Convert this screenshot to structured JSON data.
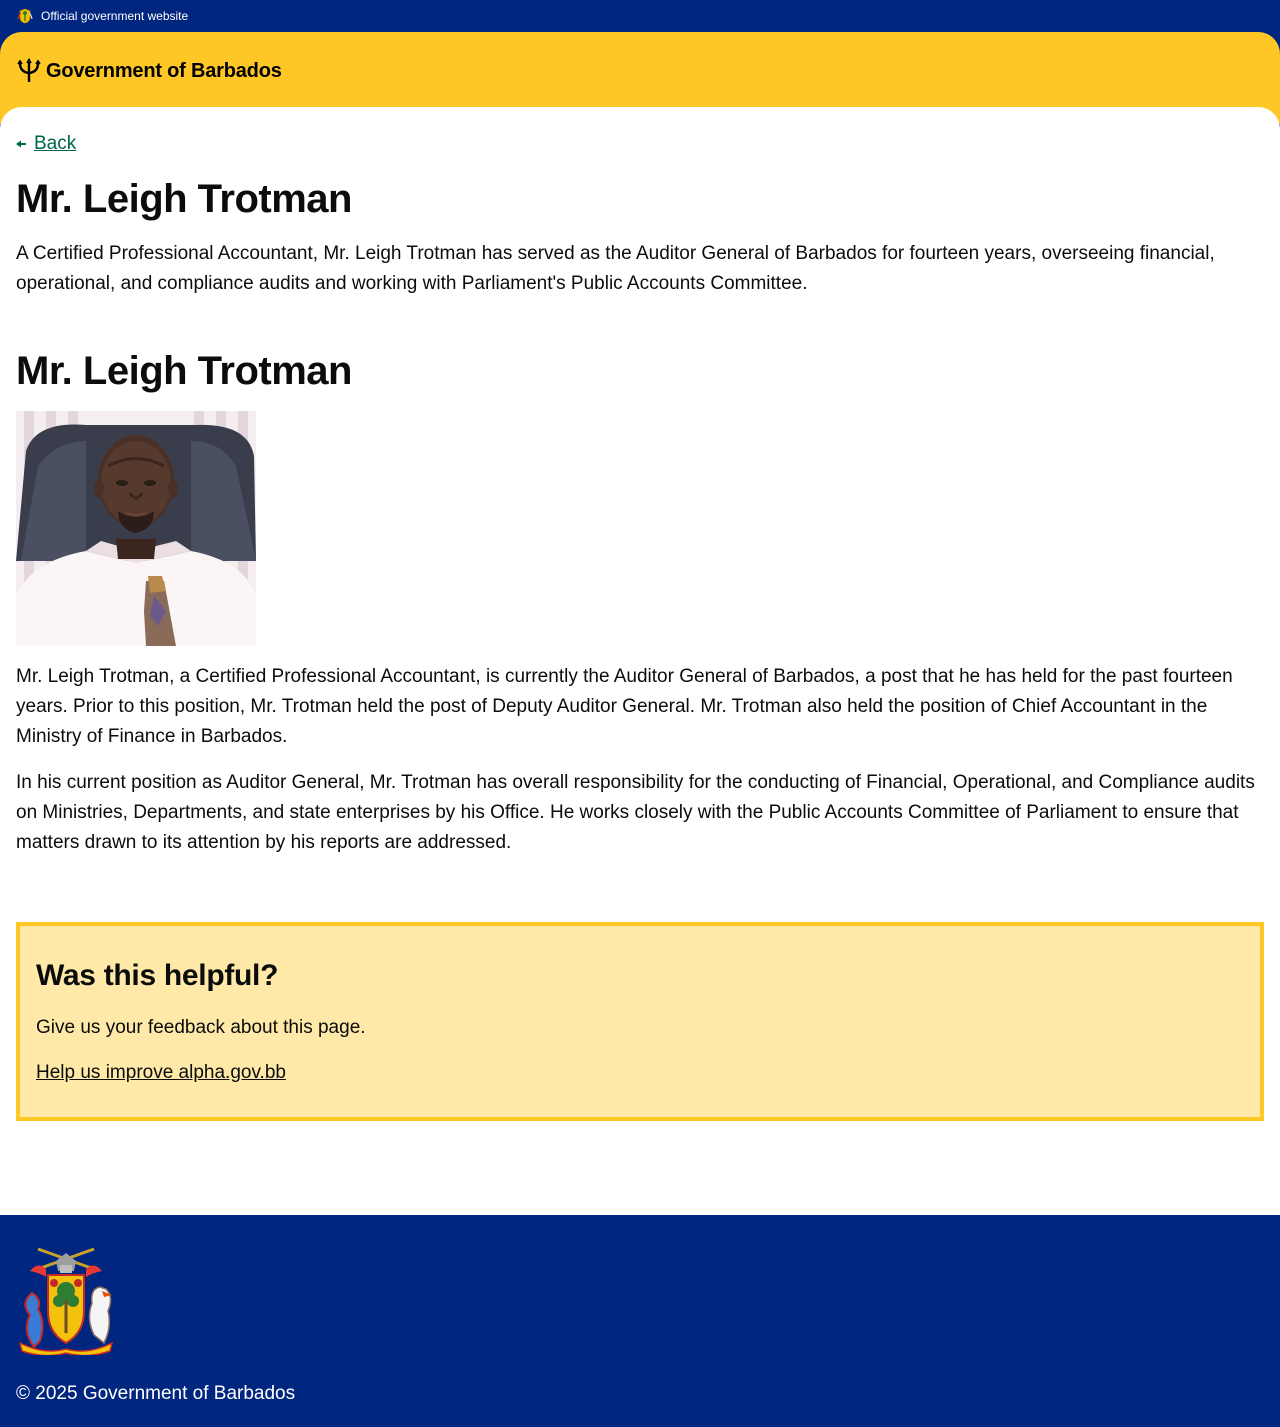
{
  "topbar": {
    "official_text": "Official government website",
    "crest_icon": "barbados-crest-icon"
  },
  "header": {
    "brand_text": "Government of Barbados",
    "brand_icon": "trident-icon",
    "brand_color": "#ffc726"
  },
  "nav": {
    "back_label": "Back",
    "back_icon": "arrow-left-icon",
    "link_color": "#00654a"
  },
  "page": {
    "title": "Mr. Leigh Trotman",
    "summary": "A Certified Professional Accountant, Mr. Leigh Trotman has served as the Auditor General of Barbados for fourteen years, overseeing financial, operational, and compliance audits and working with Parliament's Public Accounts Committee."
  },
  "profile": {
    "heading": "Mr. Leigh Trotman",
    "bio_paragraphs": [
      "Mr. Leigh Trotman, a Certified Professional Accountant, is currently the Auditor General of Barbados, a post that he has held for the past fourteen years. Prior to this position, Mr. Trotman held the post of Deputy Auditor General. Mr. Trotman also held the position of Chief Accountant in the Ministry of Finance in Barbados.",
      "In his current position as Auditor General, Mr. Trotman has overall responsibility for the conducting of Financial, Operational, and Compliance audits on Ministries, Departments, and state enterprises by his Office. He works closely with the Public Accounts Committee of Parliament to ensure that matters drawn to its attention by his reports are addressed."
    ]
  },
  "feedback": {
    "heading": "Was this helpful?",
    "text": "Give us your feedback about this page.",
    "link_label": "Help us improve alpha.gov.bb",
    "bg_color": "#ffe9a8",
    "border_color": "#ffc726"
  },
  "footer": {
    "copyright": "© 2025 Government of Barbados",
    "coat_of_arms_icon": "coat-of-arms-icon",
    "bg_color": "#00267f"
  }
}
